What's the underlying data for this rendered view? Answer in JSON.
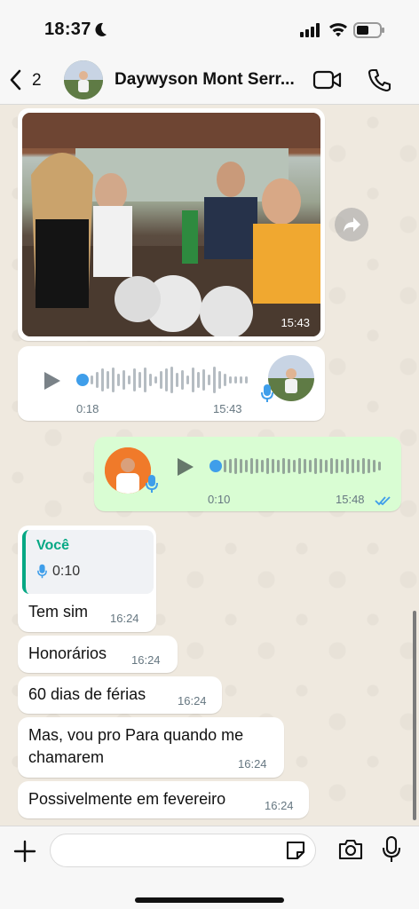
{
  "status_bar": {
    "time": "18:37"
  },
  "header": {
    "back_count": "2",
    "contact_name": "Daywyson Mont Serr..."
  },
  "messages": [
    {
      "type": "photo",
      "direction": "in",
      "time": "15:43"
    },
    {
      "type": "voice",
      "direction": "in",
      "duration": "0:18",
      "time": "15:43"
    },
    {
      "type": "voice",
      "direction": "out",
      "duration": "0:10",
      "time": "15:48",
      "status": "read"
    },
    {
      "type": "reply",
      "direction": "in",
      "quote_author": "Você",
      "quote_duration": "0:10",
      "text": "Tem sim",
      "time": "16:24"
    },
    {
      "type": "text",
      "direction": "in",
      "text": "Honorários",
      "time": "16:24"
    },
    {
      "type": "text",
      "direction": "in",
      "text": "60 dias de férias",
      "time": "16:24"
    },
    {
      "type": "text",
      "direction": "in",
      "text": "Mas, vou pro Para quando me chamarem",
      "time": "16:24"
    },
    {
      "type": "text",
      "direction": "in",
      "text": "Possivelmente em fevereiro",
      "time": "16:24"
    }
  ],
  "input": {
    "value": ""
  },
  "colors": {
    "accent": "#06a884",
    "outgoing_bubble": "#d9fdd3",
    "read_ticks": "#3f9eea",
    "voice_dot": "#3f9eea"
  },
  "icons": [
    "back-icon",
    "video-call-icon",
    "phone-icon",
    "forward-icon",
    "play-icon",
    "mic-icon",
    "plus-icon",
    "sticker-icon",
    "camera-icon",
    "read-ticks-icon"
  ]
}
